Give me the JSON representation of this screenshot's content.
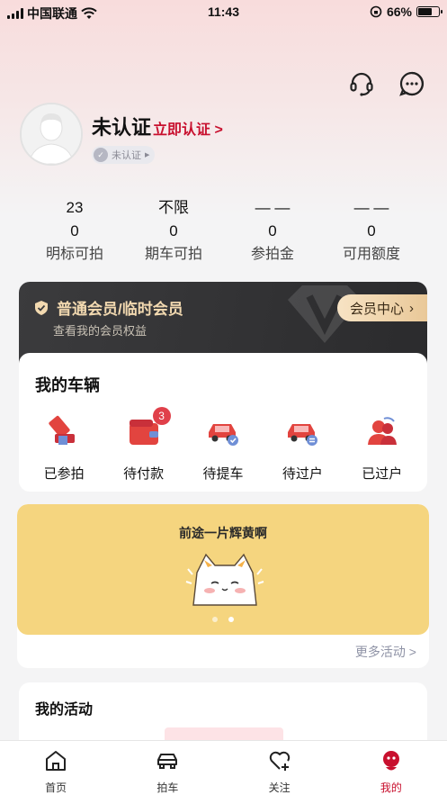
{
  "status_bar": {
    "carrier": "中国联通",
    "time": "11:43",
    "battery": "66%",
    "battery_level": 0.66
  },
  "header": {
    "service_icon": "headset-icon",
    "message_icon": "chat-icon"
  },
  "profile": {
    "name": "未认证",
    "verify_link": "立即认证 >",
    "badge": "未认证"
  },
  "stats": [
    {
      "top": "23",
      "value": "0",
      "label": "明标可拍"
    },
    {
      "top": "不限",
      "value": "0",
      "label": "期车可拍"
    },
    {
      "top": "— —",
      "value": "0",
      "label": "参拍金"
    },
    {
      "top": "— —",
      "value": "0",
      "label": "可用额度"
    }
  ],
  "vip": {
    "title": "普通会员/临时会员",
    "subtitle": "查看我的会员权益",
    "button": "会员中心"
  },
  "vehicles": {
    "title": "我的车辆",
    "items": [
      {
        "label": "已参拍",
        "icon": "gavel-icon"
      },
      {
        "label": "待付款",
        "icon": "wallet-icon",
        "badge": "3"
      },
      {
        "label": "待提车",
        "icon": "car-pickup-icon"
      },
      {
        "label": "待过户",
        "icon": "car-transfer-icon"
      },
      {
        "label": "已过户",
        "icon": "people-transfer-icon"
      }
    ]
  },
  "banner": {
    "title": "前途一片辉黄啊",
    "more": "更多活动 >",
    "colors": {
      "background": "#f5d57f"
    }
  },
  "activity": {
    "title": "我的活动"
  },
  "tabbar": {
    "items": [
      {
        "label": "首页",
        "icon": "home-icon"
      },
      {
        "label": "拍车",
        "icon": "car-icon"
      },
      {
        "label": "关注",
        "icon": "heart-plus-icon"
      },
      {
        "label": "我的",
        "icon": "profile-icon",
        "active": true
      }
    ]
  },
  "colors": {
    "accent": "#c8102e",
    "vip_gold": "#f2d9b0"
  }
}
